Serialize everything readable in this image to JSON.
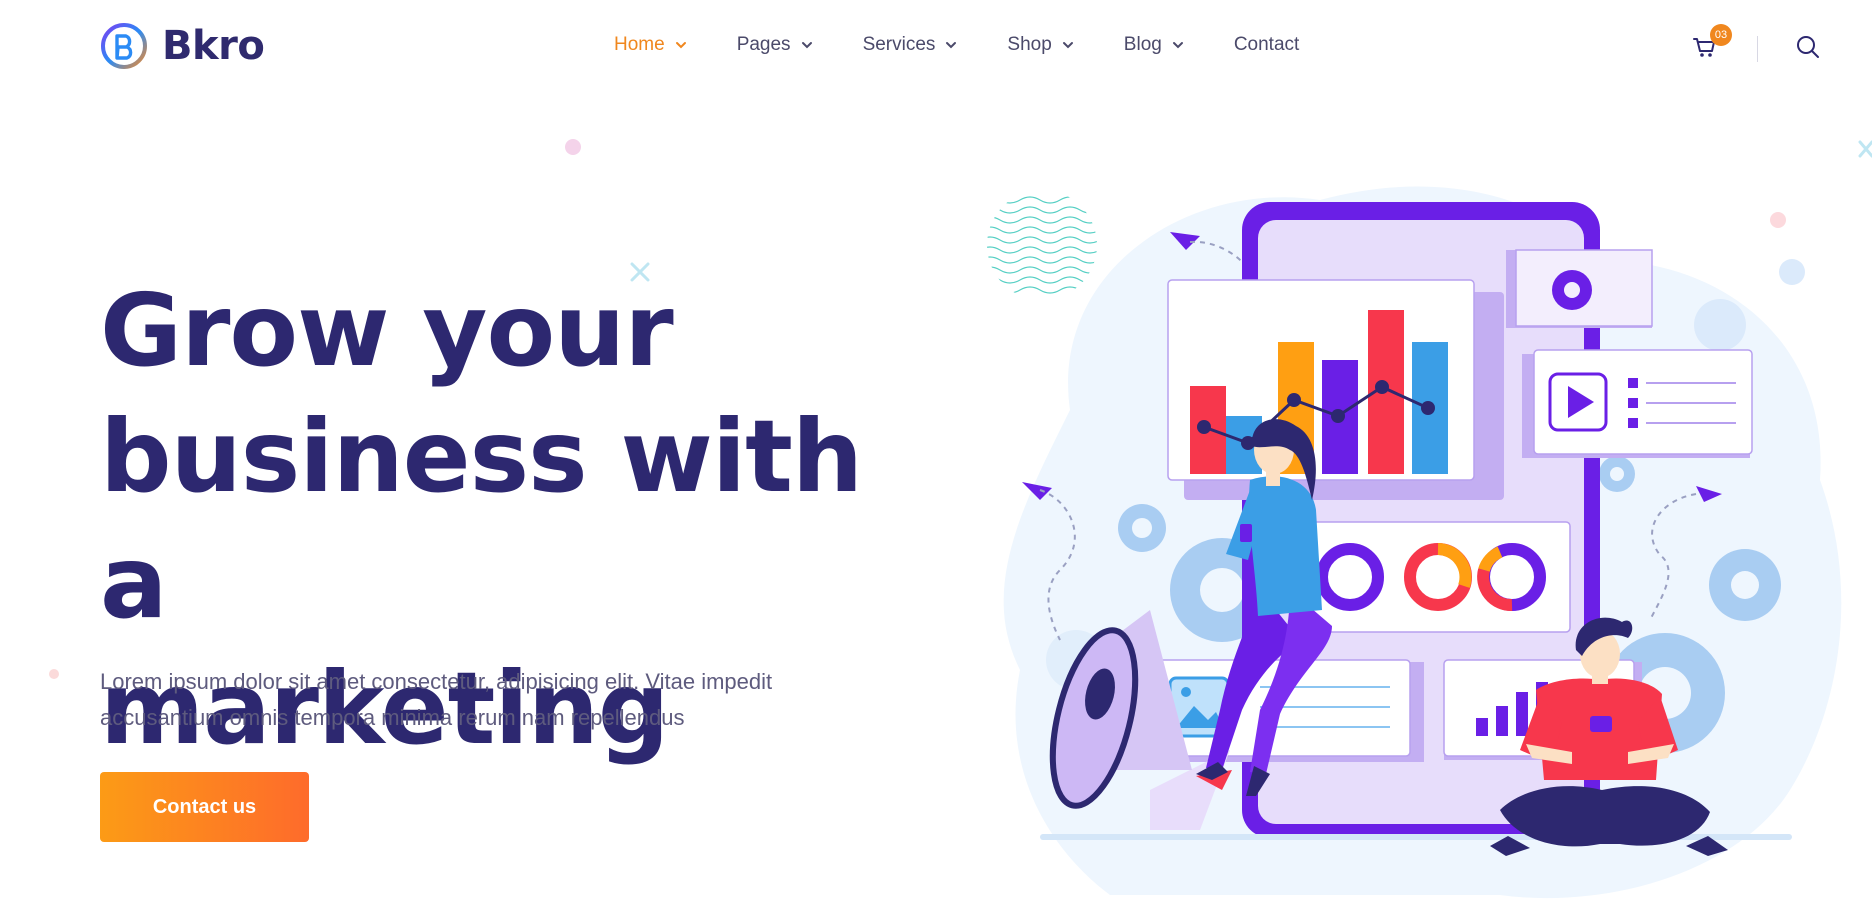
{
  "brand": {
    "name": "Bkro",
    "logo_icon": "b-logo-icon",
    "accent": "#f0871e",
    "primary": "#2d2870"
  },
  "nav": {
    "items": [
      {
        "label": "Home",
        "active": true,
        "has_dropdown": true
      },
      {
        "label": "Pages",
        "active": false,
        "has_dropdown": true
      },
      {
        "label": "Services",
        "active": false,
        "has_dropdown": true
      },
      {
        "label": "Shop",
        "active": false,
        "has_dropdown": true
      },
      {
        "label": "Blog",
        "active": false,
        "has_dropdown": true
      },
      {
        "label": "Contact",
        "active": false,
        "has_dropdown": false
      }
    ]
  },
  "header_actions": {
    "cart_icon": "cart-icon",
    "cart_count": "03",
    "search_icon": "search-icon"
  },
  "hero": {
    "title_line1": "Grow your",
    "title_line2": "business with a",
    "title_line3": "marketing",
    "description_line1": "Lorem ipsum dolor sit amet consectetur, adipisicing elit. Vitae impedit",
    "description_line2": "accusantium omnis tempora minima rerum nam repellendus",
    "cta_label": "Contact us",
    "cta_gradient": [
      "#fc9b16",
      "#fe6b2b"
    ]
  },
  "illustration": {
    "subject": "marketing-illustration",
    "colors": {
      "purple": "#6a1fe6",
      "red": "#f7374c",
      "orange": "#ff9f12",
      "blue": "#3b9ee6",
      "light_blue": "#d9ebfb"
    }
  }
}
